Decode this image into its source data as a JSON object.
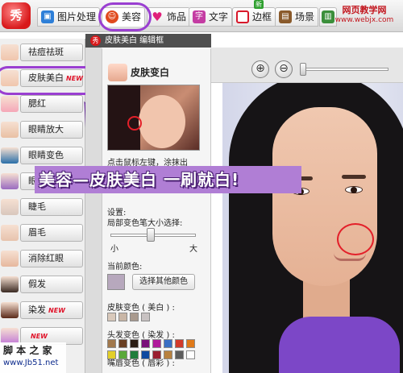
{
  "app": {
    "logo_text": "秀"
  },
  "tabs": [
    {
      "label": "图片处理",
      "icon": "image-icon",
      "color": "#2e7fd8"
    },
    {
      "label": "美容",
      "icon": "face-icon",
      "color": "#e04a1d",
      "active": true
    },
    {
      "label": "饰品",
      "icon": "heart-icon",
      "color": "#e0207a"
    },
    {
      "label": "文字",
      "icon": "text-icon",
      "color": "#c43ca3"
    },
    {
      "label": "边框",
      "icon": "frame-icon",
      "color": "#d8182a"
    },
    {
      "label": "场景",
      "icon": "scene-icon",
      "color": "#8a5a2b"
    },
    {
      "label": "",
      "icon": "collage-icon",
      "color": "#3b8f3b"
    }
  ],
  "frame_badge": "新",
  "watermark": {
    "line1": "网页教学网",
    "line2": "www.webjx.com"
  },
  "tools": [
    {
      "label": "祛痘祛斑",
      "new": false
    },
    {
      "label": "皮肤美白",
      "new": true
    },
    {
      "label": "腮红",
      "new": false
    },
    {
      "label": "眼睛放大",
      "new": false
    },
    {
      "label": "眼睛变色",
      "new": false
    },
    {
      "label": "眼影",
      "new": false
    },
    {
      "label": "睫毛",
      "new": false
    },
    {
      "label": "眉毛",
      "new": false
    },
    {
      "label": "消除红眼",
      "new": false
    },
    {
      "label": "假发",
      "new": false
    },
    {
      "label": "染发",
      "new": true
    },
    {
      "label": "",
      "new": true
    }
  ],
  "new_label": "NEW",
  "site_mark": {
    "line1": "脚 本 之 家",
    "line2": "www.Jb51.net"
  },
  "panel": {
    "window_title": "皮肤美白 编辑框",
    "heading": "皮肤变白",
    "hint": "点击鼠标左键，涂抹出",
    "settings_label": "设置:",
    "brush_label": "局部变色笔大小选择:",
    "size_min": "小",
    "size_max": "大",
    "brush_size_fraction": 0.47,
    "current_color_label": "当前颜色:",
    "current_color": "#b7a8bd",
    "other_color_button": "选择其他颜色",
    "skin_group": "皮肤变色 ( 美白 ) :",
    "skin_colors": [
      "#d9c9bb",
      "#c9b6a6",
      "#a99a8e",
      "#c8c2c2"
    ],
    "hair_group": "头发变色 ( 染发 ) :",
    "hair_colors": [
      "#a1784c",
      "#6a3f22",
      "#2a1d14",
      "#7a0f7a",
      "#b01a9b",
      "#3a6fc4",
      "#d23a2a",
      "#e07a19",
      "#e3cf29",
      "#5aa83a",
      "#1f7d3c",
      "#0f4aa0",
      "#9a1f2f",
      "#b8813f",
      "#5d5d5d",
      "#ffffff"
    ],
    "lip_group": "嘴唇变色 ( 唇彩 ) :",
    "lip_colors": [
      "#d43a7a",
      "#c82c2c",
      "#e07a73",
      "#b72f9a",
      "#e24f9f",
      "#8f1f3f",
      "#f39ab5",
      "#d07a3a"
    ]
  },
  "banner": {
    "text": "美容—皮肤美白 一刷就白!"
  },
  "zoom": {
    "level_fraction": 0.0
  }
}
